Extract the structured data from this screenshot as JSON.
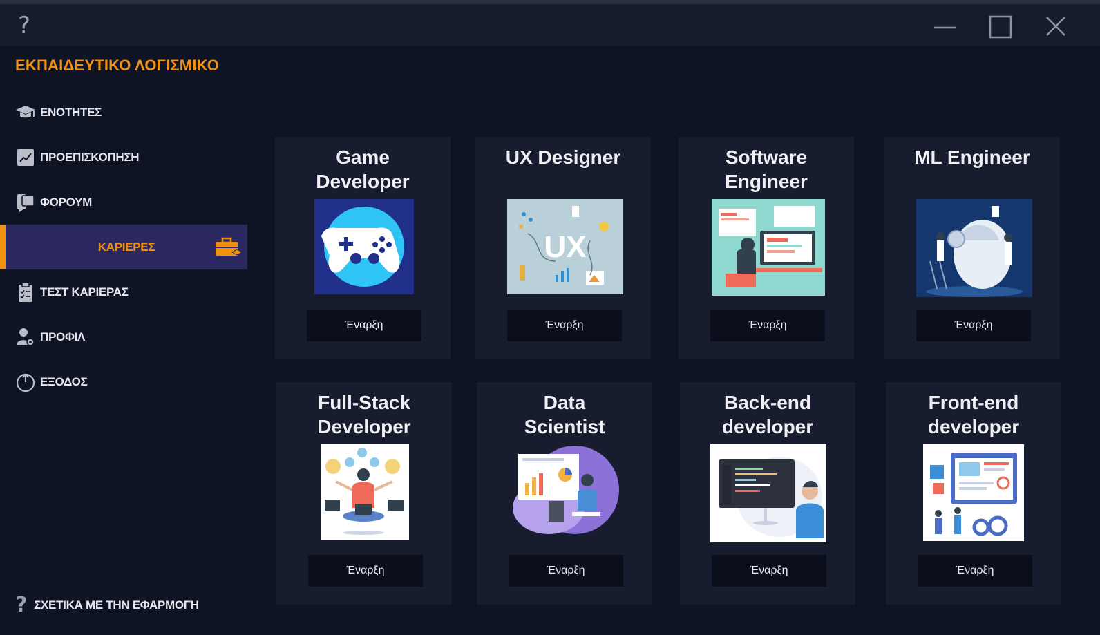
{
  "window": {
    "help_symbol": "?"
  },
  "app": {
    "title": "ΕΚΠΑΙΔΕΥΤΙΚΟ ΛΟΓΙΣΜΙΚΟ"
  },
  "sidebar": {
    "items": [
      {
        "label": "ΕΝΟΤΗΤΕΣ",
        "icon": "graduation-cap-icon"
      },
      {
        "label": "ΠΡΟΕΠΙΣΚΟΠΗΣΗ",
        "icon": "chart-icon"
      },
      {
        "label": "ΦΟΡΟΥΜ",
        "icon": "forum-icon"
      },
      {
        "label": "ΚΑΡΙΕΡΕΣ",
        "icon": "briefcase-icon",
        "active": true
      },
      {
        "label": "ΤΕΣΤ ΚΑΡΙΕΡΑΣ",
        "icon": "clipboard-icon"
      },
      {
        "label": "ΠΡΟΦΙΛ",
        "icon": "user-settings-icon"
      },
      {
        "label": "ΕΞΟΔΟΣ",
        "icon": "power-icon"
      }
    ],
    "about": {
      "label": "ΣΧΕΤΙΚΑ ΜΕ ΤΗΝ ΕΦΑΡΜΟΓΗ",
      "symbol": "?"
    }
  },
  "accent_color": "#f29111",
  "active_bg_color": "#2b2761",
  "careers": [
    {
      "title_line1": "Game",
      "title_line2": "Developer",
      "button": "Έναρξη"
    },
    {
      "title_line1": "UX Designer",
      "title_line2": "",
      "button": "Έναρξη"
    },
    {
      "title_line1": "Software",
      "title_line2": "Engineer",
      "button": "Έναρξη"
    },
    {
      "title_line1": "ML Engineer",
      "title_line2": "",
      "button": "Έναρξη"
    },
    {
      "title_line1": "Full-Stack",
      "title_line2": "Developer",
      "button": "Έναρξη"
    },
    {
      "title_line1": "Data",
      "title_line2": "Scientist",
      "button": "Έναρξη"
    },
    {
      "title_line1": "Back-end",
      "title_line2": "developer",
      "button": "Έναρξη"
    },
    {
      "title_line1": "Front-end",
      "title_line2": "developer",
      "button": "Έναρξη"
    }
  ]
}
